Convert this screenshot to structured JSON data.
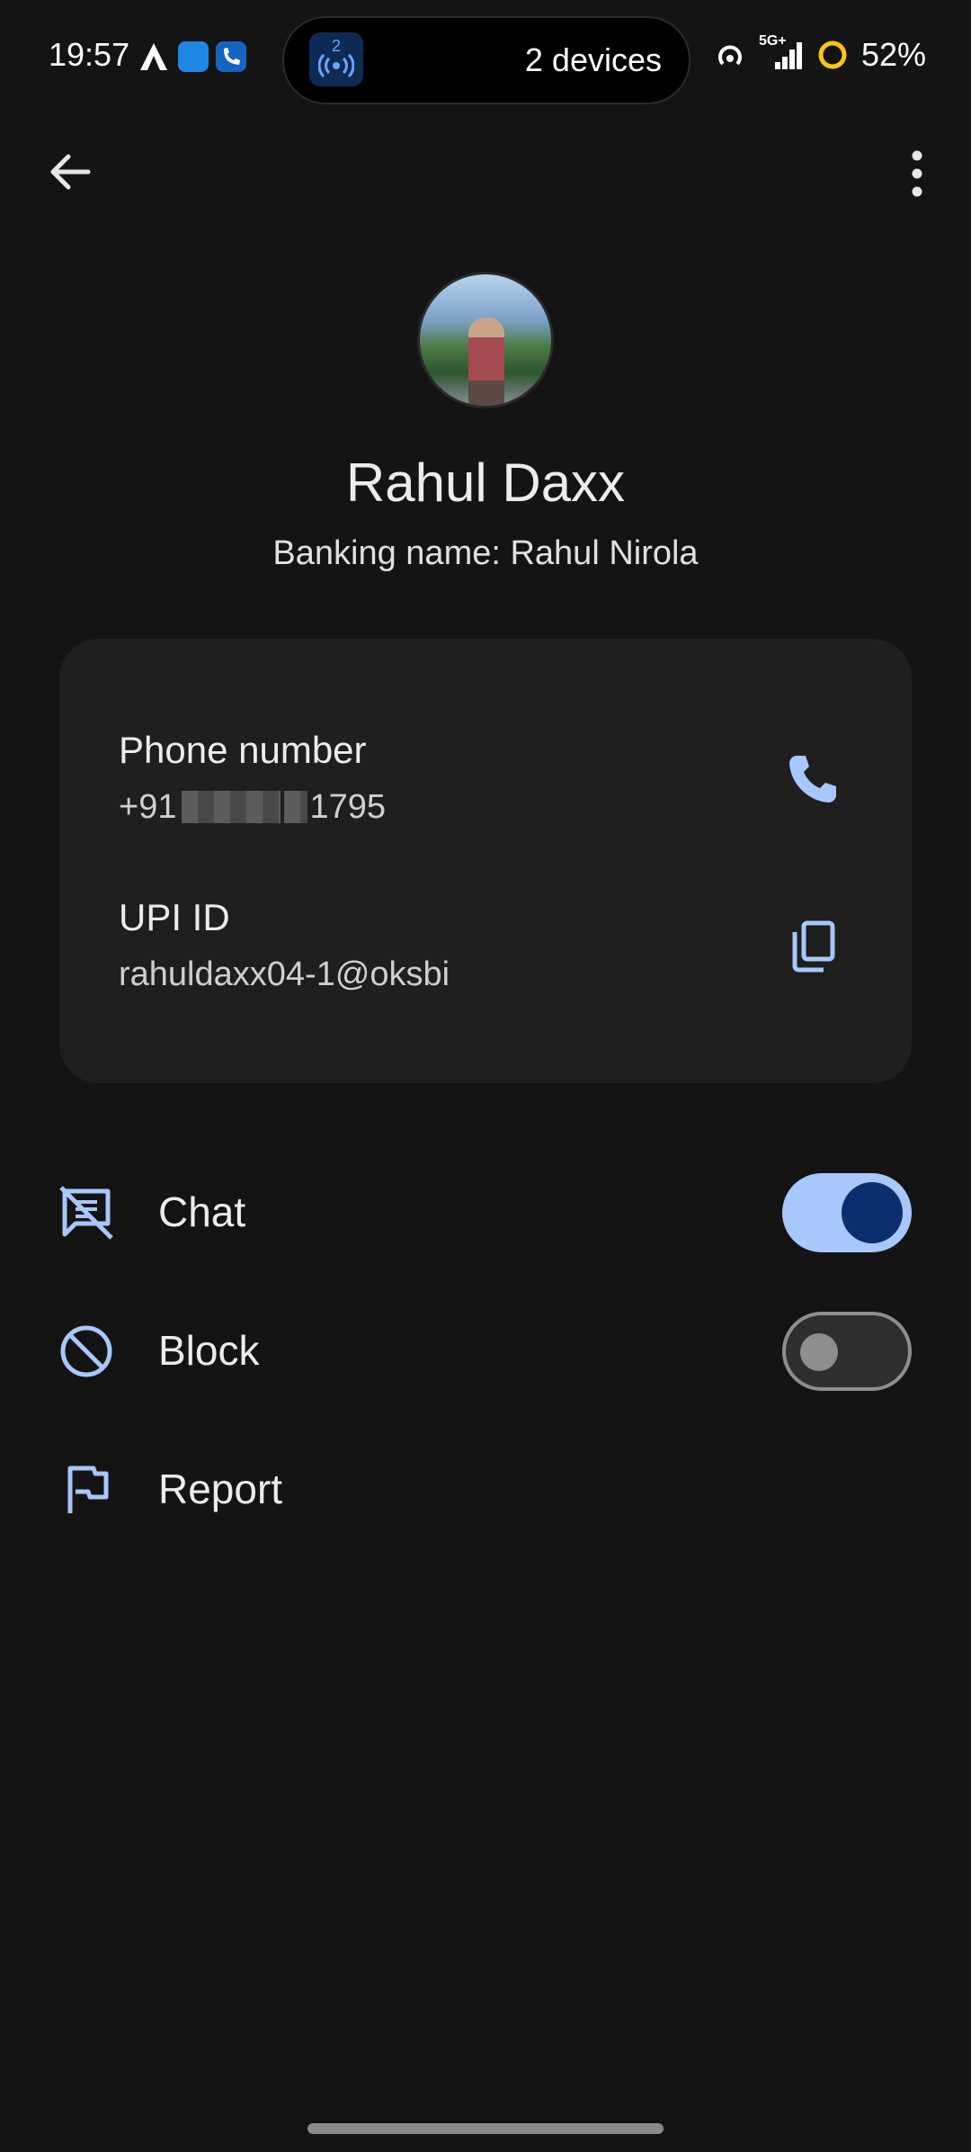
{
  "status": {
    "time": "19:57",
    "island_text": "2 devices",
    "island_badge": "2",
    "network": "5G+",
    "battery": "52%"
  },
  "header": {
    "name": "Rahul Daxx",
    "banking_name": "Banking name: Rahul  Nirola"
  },
  "card": {
    "phone_label": "Phone number",
    "phone_prefix": "+91",
    "phone_suffix": "1795",
    "upi_label": "UPI ID",
    "upi_value": "rahuldaxx04-1@oksbi"
  },
  "options": {
    "chat_label": "Chat",
    "chat_enabled": true,
    "block_label": "Block",
    "block_enabled": false,
    "report_label": "Report"
  },
  "colors": {
    "accent": "#a8c7fa",
    "accent_dark": "#0b2e6e",
    "background": "#141414",
    "card": "#1f1f1f"
  }
}
